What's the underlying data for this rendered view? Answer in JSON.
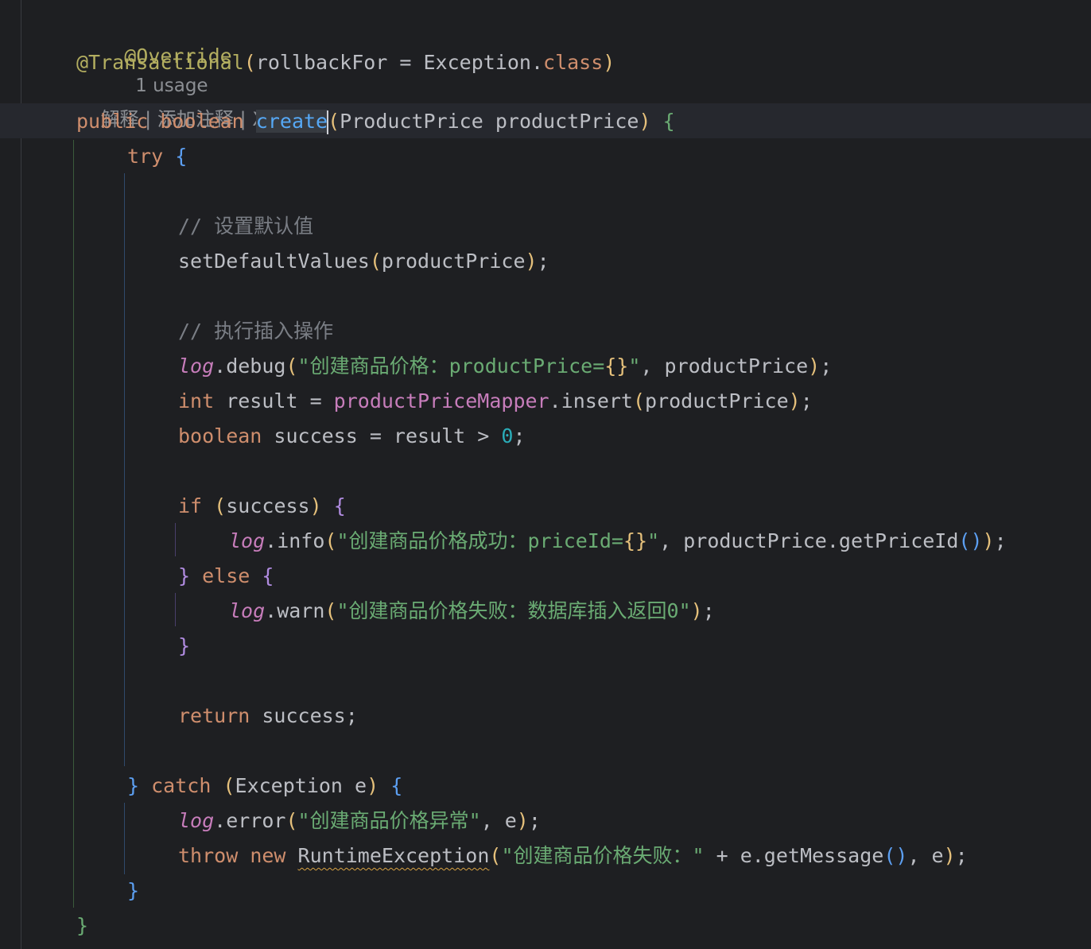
{
  "editor": {
    "lines": {
      "l0": {
        "override": "@Override",
        "usage": "1 usage"
      },
      "l1": {
        "annot": "@Transactional",
        "open": "(",
        "arg": "rollbackFor = Exception.",
        "cls": "class",
        "close": ")"
      },
      "l2": {
        "hint": "解释 | 添加注释 | X"
      },
      "l3": {
        "public": "public",
        "boolean": "boolean",
        "create": "create",
        "open": "(",
        "params": "ProductPrice productPrice",
        "close": ")",
        "brace": "{"
      },
      "l4": {
        "try": "try",
        "brace": "{"
      },
      "l5": {
        "comment": "// 设置默认值"
      },
      "l6": {
        "call": "setDefaultValues",
        "open": "(",
        "arg": "productPrice",
        "close": ")",
        "semi": ";"
      },
      "l7": {
        "comment": "// 执行插入操作"
      },
      "l8": {
        "log": "log",
        "method": ".debug",
        "open": "(",
        "str": "\"创建商品价格：productPrice=",
        "braces": "{}",
        "strEnd": "\"",
        "rest": ", productPrice",
        "close": ")",
        "semi": ";"
      },
      "l9": {
        "int": "int",
        "lhs": " result = ",
        "field": "productPriceMapper",
        "method": ".insert",
        "open": "(",
        "arg": "productPrice",
        "close": ")",
        "semi": ";"
      },
      "l10": {
        "boolean": "boolean",
        "rest": " success = result > ",
        "num": "0",
        "semi": ";"
      },
      "l11": {
        "if": "if",
        "open": "(",
        "arg": "success",
        "close": ")",
        "brace": "{"
      },
      "l12": {
        "log": "log",
        "method": ".info",
        "open": "(",
        "str": "\"创建商品价格成功：priceId=",
        "braces": "{}",
        "strEnd": "\"",
        "rest": ", productPrice.getPriceId",
        "innerParens": "()",
        "close": ")",
        "semi": ";"
      },
      "l13": {
        "braceClose": "}",
        "else": "else",
        "brace": "{"
      },
      "l14": {
        "log": "log",
        "method": ".warn",
        "open": "(",
        "str": "\"创建商品价格失败：数据库插入返回0\"",
        "close": ")",
        "semi": ";"
      },
      "l15": {
        "brace": "}"
      },
      "l16": {
        "return": "return",
        "rest": " success;"
      },
      "l17": {
        "braceClose": "}",
        "catch": "catch",
        "open": "(",
        "params": "Exception e",
        "close": ")",
        "brace": "{"
      },
      "l18": {
        "log": "log",
        "method": ".error",
        "open": "(",
        "str": "\"创建商品价格异常\"",
        "rest": ", e",
        "close": ")",
        "semi": ";"
      },
      "l19": {
        "throw": "throw",
        "new": "new",
        "cls": "RuntimeException",
        "open": "(",
        "str": "\"创建商品价格失败：\"",
        "mid": " + e.getMessage",
        "innerParens": "()",
        "rest": ", e",
        "close": ")",
        "semi": ";"
      },
      "l20": {
        "brace": "}"
      },
      "l21": {
        "brace": "}"
      }
    }
  },
  "colors": {
    "background": "#1e1f22",
    "keyword": "#cf8e6d",
    "string": "#6aab73",
    "annotation": "#b3ae60",
    "function": "#56a8f5",
    "field": "#c77dbb",
    "number": "#2aacb8",
    "comment": "#7a7e85"
  }
}
